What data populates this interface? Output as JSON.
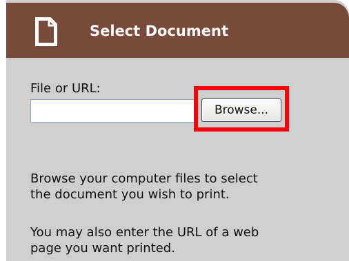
{
  "header": {
    "title": "Select Document",
    "icon": "document-icon",
    "background_color": "#784a3b"
  },
  "form": {
    "file_label": "File or URL:",
    "file_input_value": "",
    "browse_label": "Browse..."
  },
  "help": {
    "line1": "Browse your computer files to select",
    "line2": "the document you wish to print.",
    "line3": "You may also enter the URL of a web",
    "line4": "page you want printed."
  },
  "highlight_color": "#ff0000"
}
